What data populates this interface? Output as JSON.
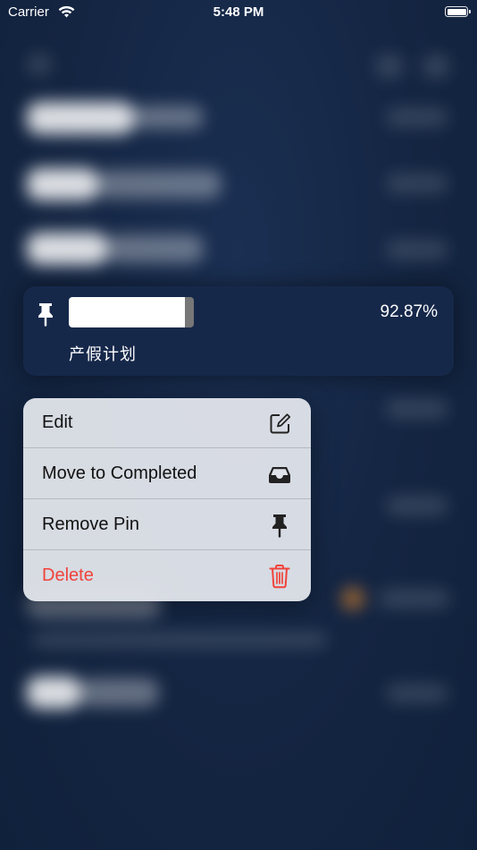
{
  "status_bar": {
    "carrier": "Carrier",
    "time": "5:48 PM"
  },
  "focused_card": {
    "progress_percent": "92.87%",
    "progress_fraction": 0.9287,
    "name": "产假计划",
    "pin_icon": "pin-icon"
  },
  "context_menu": {
    "items": [
      {
        "label": "Edit",
        "icon": "edit-icon",
        "destructive": false
      },
      {
        "label": "Move to Completed",
        "icon": "tray-icon",
        "destructive": false
      },
      {
        "label": "Remove Pin",
        "icon": "pin-icon",
        "destructive": false
      },
      {
        "label": "Delete",
        "icon": "trash-icon",
        "destructive": true
      }
    ]
  },
  "colors": {
    "background": "#142542",
    "card": "#16284a",
    "menu": "#e0e3e9",
    "destructive": "#f0433a"
  }
}
